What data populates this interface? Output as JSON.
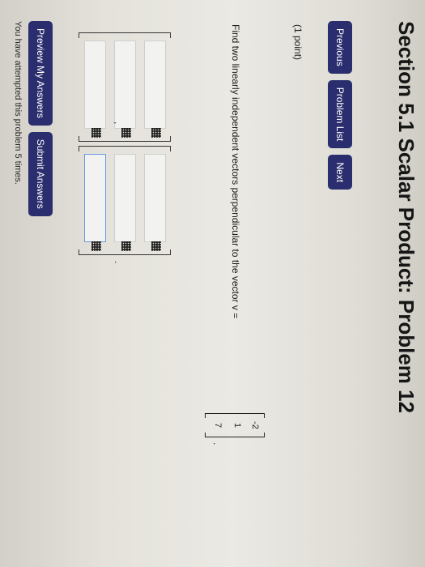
{
  "title": "Section 5.1 Scalar Product: Problem 12",
  "nav": {
    "previous": "Previous",
    "problem_list": "Problem List",
    "next": "Next"
  },
  "problem": {
    "points": "(1 point)",
    "question": "Find two linearly independent vectors perpendicular to the vector v =",
    "vector": [
      "-2",
      "1",
      "7"
    ],
    "period": ".",
    "comma": ","
  },
  "actions": {
    "preview": "Preview My Answers",
    "submit": "Submit Answers"
  },
  "attempts": "You have attempted this problem 5 times.",
  "colors": {
    "button_bg": "#2a2e6e",
    "button_text": "#ffffff",
    "active_input_border": "#6a9ae0"
  },
  "icons": [
    "matrix-grid-icon"
  ]
}
